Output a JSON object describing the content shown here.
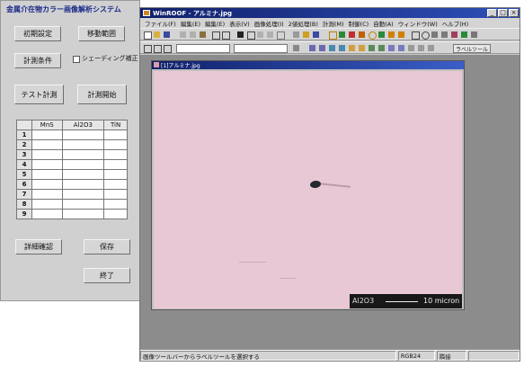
{
  "panel": {
    "title": "金属介在物カラー画像解析システム",
    "buttons": {
      "initial_settings": "初期設定",
      "movement_range": "移動範囲",
      "measure_conditions": "計測条件",
      "shading_correction": "シェーディング補正",
      "test_measure": "テスト計測",
      "start_measure": "計測開始",
      "details_confirm": "詳細確認",
      "save": "保存",
      "exit": "終了"
    },
    "shading_checked": false,
    "table": {
      "headers": [
        "MnS",
        "Al2O3",
        "TiN"
      ],
      "rows": [
        "1",
        "2",
        "3",
        "4",
        "5",
        "6",
        "7",
        "8",
        "9"
      ]
    }
  },
  "window": {
    "title": "WinROOF - アルミナ.jpg",
    "menu": [
      "ファイル(F)",
      "編集(E)",
      "編集(E)",
      "表示(V)",
      "画像処理(I)",
      "2値処理(B)",
      "計測(M)",
      "制御(C)",
      "自動(A)",
      "ウィンドウ(W)",
      "ヘルプ(H)"
    ],
    "toolbar_button_label": "ラベルツール",
    "status": {
      "hint": "画像ツールバーからラベルツールを選択する",
      "mode": "RGB24",
      "state": "隣接"
    }
  },
  "image_window": {
    "title": "[1]アルミナ.jpg",
    "scale_material": "Al2O3",
    "scale_label": "10 micron"
  }
}
